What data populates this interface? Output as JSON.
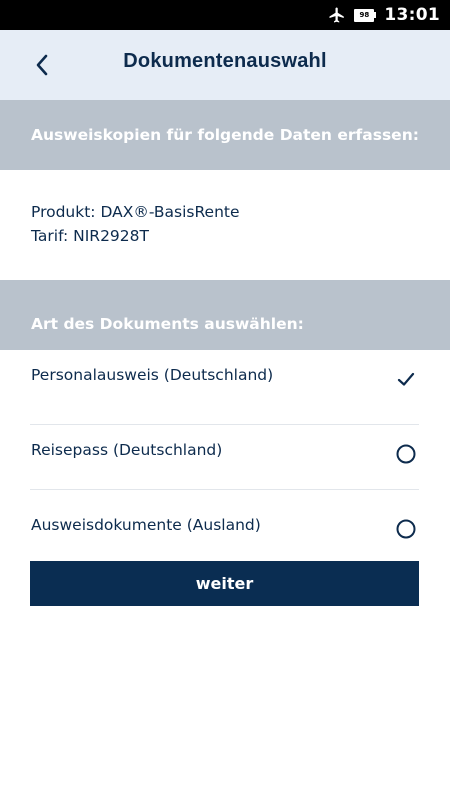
{
  "status_bar": {
    "battery_level": "98",
    "time": "13:01",
    "icons": [
      "airplane-mode-icon",
      "battery-icon"
    ]
  },
  "header": {
    "title": "Dokumentenauswahl",
    "back_icon": "chevron-left-icon"
  },
  "capture_section": {
    "heading": "Ausweiskopien für folgende Daten erfassen:",
    "product_line": "Produkt: DAX®-BasisRente",
    "tariff_line": "Tarif: NIR2928T"
  },
  "document_section": {
    "heading": "Art des Dokuments auswählen:",
    "options": [
      {
        "label": "Personalausweis (Deutschland)",
        "selected": true
      },
      {
        "label": "Reisepass (Deutschland)",
        "selected": false
      },
      {
        "label": "Ausweisdokumente (Ausland)",
        "selected": false
      }
    ]
  },
  "actions": {
    "next_label": "weiter"
  },
  "colors": {
    "primary_navy": "#0a2d52",
    "text_navy": "#0d2b4d",
    "header_bg": "#e6edf6",
    "section_bg": "#b9c2cc"
  }
}
